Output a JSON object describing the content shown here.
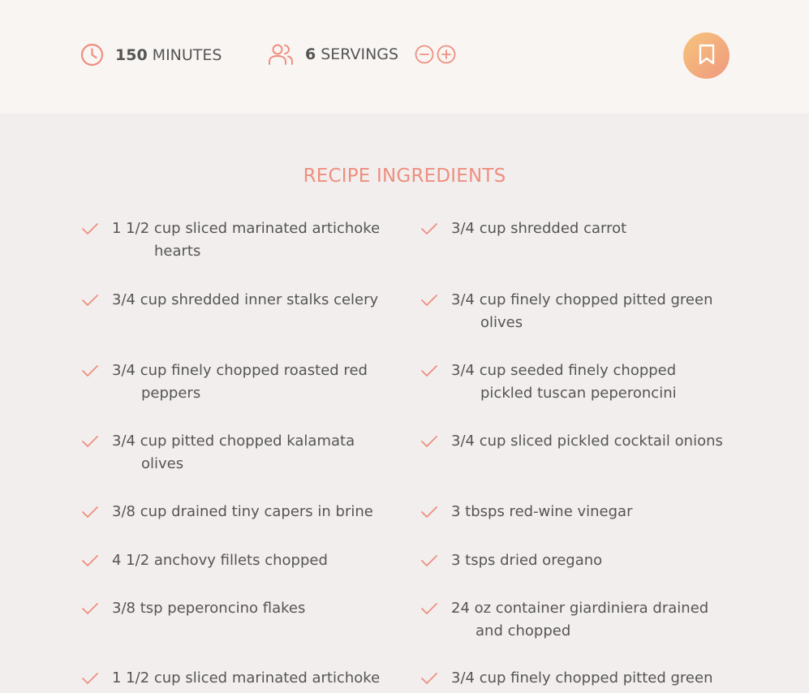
{
  "recipe_meta": {
    "time_value": "150",
    "time_unit": "MINUTES",
    "servings_value": "6",
    "servings_unit": "SERVINGS"
  },
  "ingredients_title": "RECIPE INGREDIENTS",
  "ingredients": [
    {
      "line1": "1 1/2 cup sliced marinated artichoke",
      "line2": "hearts"
    },
    {
      "line1": "3/4 cup shredded carrot",
      "line2": ""
    },
    {
      "line1": "3/4 cup shredded inner stalks celery",
      "line2": ""
    },
    {
      "line1": "3/4 cup finely chopped pitted green",
      "line2": "olives"
    },
    {
      "line1": "3/4 cup finely chopped roasted red",
      "line2": "peppers"
    },
    {
      "line1": "3/4 cup seeded finely chopped",
      "line2": "pickled tuscan peperoncini"
    },
    {
      "line1": "3/4 cup pitted chopped kalamata",
      "line2": "olives"
    },
    {
      "line1": "3/4 cup sliced pickled cocktail onions",
      "line2": ""
    },
    {
      "line1": "3/8 cup drained tiny capers in brine",
      "line2": ""
    },
    {
      "line1": "3 tbsps red-wine vinegar",
      "line2": ""
    },
    {
      "line1": "4 1/2 anchovy fillets chopped",
      "line2": ""
    },
    {
      "line1": "3 tsps dried oregano",
      "line2": ""
    },
    {
      "line1": "3/8 tsp peperoncino flakes",
      "line2": ""
    },
    {
      "line1": "24 oz container giardiniera drained",
      "line2": "and chopped"
    },
    {
      "line1": "1 1/2 cup sliced marinated artichoke",
      "line2": ""
    },
    {
      "line1": "3/4 cup finely chopped pitted green",
      "line2": ""
    }
  ],
  "colors": {
    "accent": "#ee8f80",
    "text": "#555555",
    "background": "#f2eeed",
    "topbar": "#f9f5f3"
  },
  "icons": [
    "clock-icon",
    "users-icon",
    "minus-circle-icon",
    "plus-circle-icon",
    "bookmark-icon",
    "check-icon"
  ]
}
